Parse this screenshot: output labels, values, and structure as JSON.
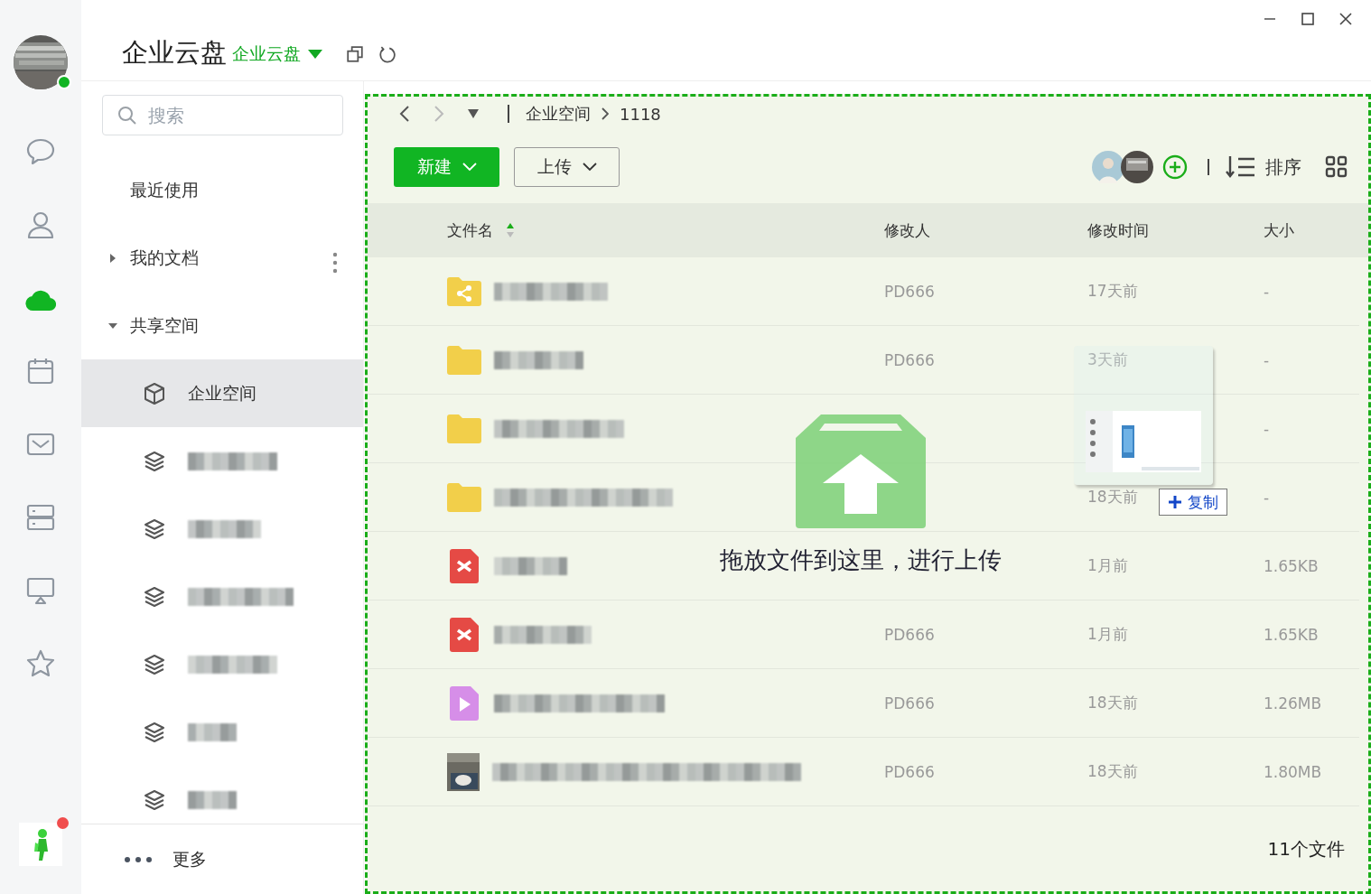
{
  "header": {
    "title": "企业云盘",
    "space_switch": "企业云盘"
  },
  "rail": {
    "items": [
      {
        "kind": "chat",
        "selected": false
      },
      {
        "kind": "contacts",
        "selected": false
      },
      {
        "kind": "cloud",
        "selected": true
      },
      {
        "kind": "calendar",
        "selected": false
      },
      {
        "kind": "mail",
        "selected": false
      },
      {
        "kind": "server",
        "selected": false
      },
      {
        "kind": "screen",
        "selected": false
      },
      {
        "kind": "star",
        "selected": false
      }
    ],
    "online": true,
    "app_badge": true
  },
  "sidebar": {
    "search": {
      "placeholder": "搜索"
    },
    "items": [
      {
        "label": "最近使用",
        "kind": "plain"
      },
      {
        "label": "我的文档",
        "kind": "group",
        "expanded": false
      },
      {
        "label": "共享空间",
        "kind": "group",
        "expanded": true,
        "children": [
          {
            "kind": "space",
            "label": "企业空间",
            "selected": true
          },
          {
            "kind": "layer",
            "selected": false
          },
          {
            "kind": "layer",
            "selected": false
          },
          {
            "kind": "layer",
            "selected": false
          },
          {
            "kind": "layer",
            "selected": false
          },
          {
            "kind": "layer",
            "selected": false
          },
          {
            "kind": "layer",
            "selected": false
          }
        ]
      }
    ],
    "more": "更多"
  },
  "breadcrumb": [
    "企业空间",
    "1118"
  ],
  "toolbar": {
    "new_button": "新建",
    "upload_button": "上传",
    "sort": "排序"
  },
  "table": {
    "columns": [
      "文件名",
      "修改人",
      "修改时间",
      "大小"
    ],
    "rows": [
      {
        "kind": "shared-folder",
        "modifier": "PD666",
        "time": "17天前",
        "size": "-"
      },
      {
        "kind": "folder",
        "modifier": "PD666",
        "time": "3天前",
        "size": "-"
      },
      {
        "kind": "folder",
        "size": "-"
      },
      {
        "kind": "folder",
        "time": "18天前",
        "size": "-"
      },
      {
        "kind": "doc",
        "time": "1月前",
        "size": "1.65KB"
      },
      {
        "kind": "doc",
        "modifier": "PD666",
        "time": "1月前",
        "size": "1.65KB"
      },
      {
        "kind": "video",
        "modifier": "PD666",
        "time": "18天前",
        "size": "1.26MB"
      },
      {
        "modifier": "PD666",
        "time": "18天前",
        "size": "1.80MB"
      }
    ]
  },
  "footer": {
    "count": "11个文件"
  },
  "drop_overlay": {
    "text": "拖放文件到这里，进行上传"
  },
  "drag_ghost": {
    "copy_badge": "复制"
  }
}
